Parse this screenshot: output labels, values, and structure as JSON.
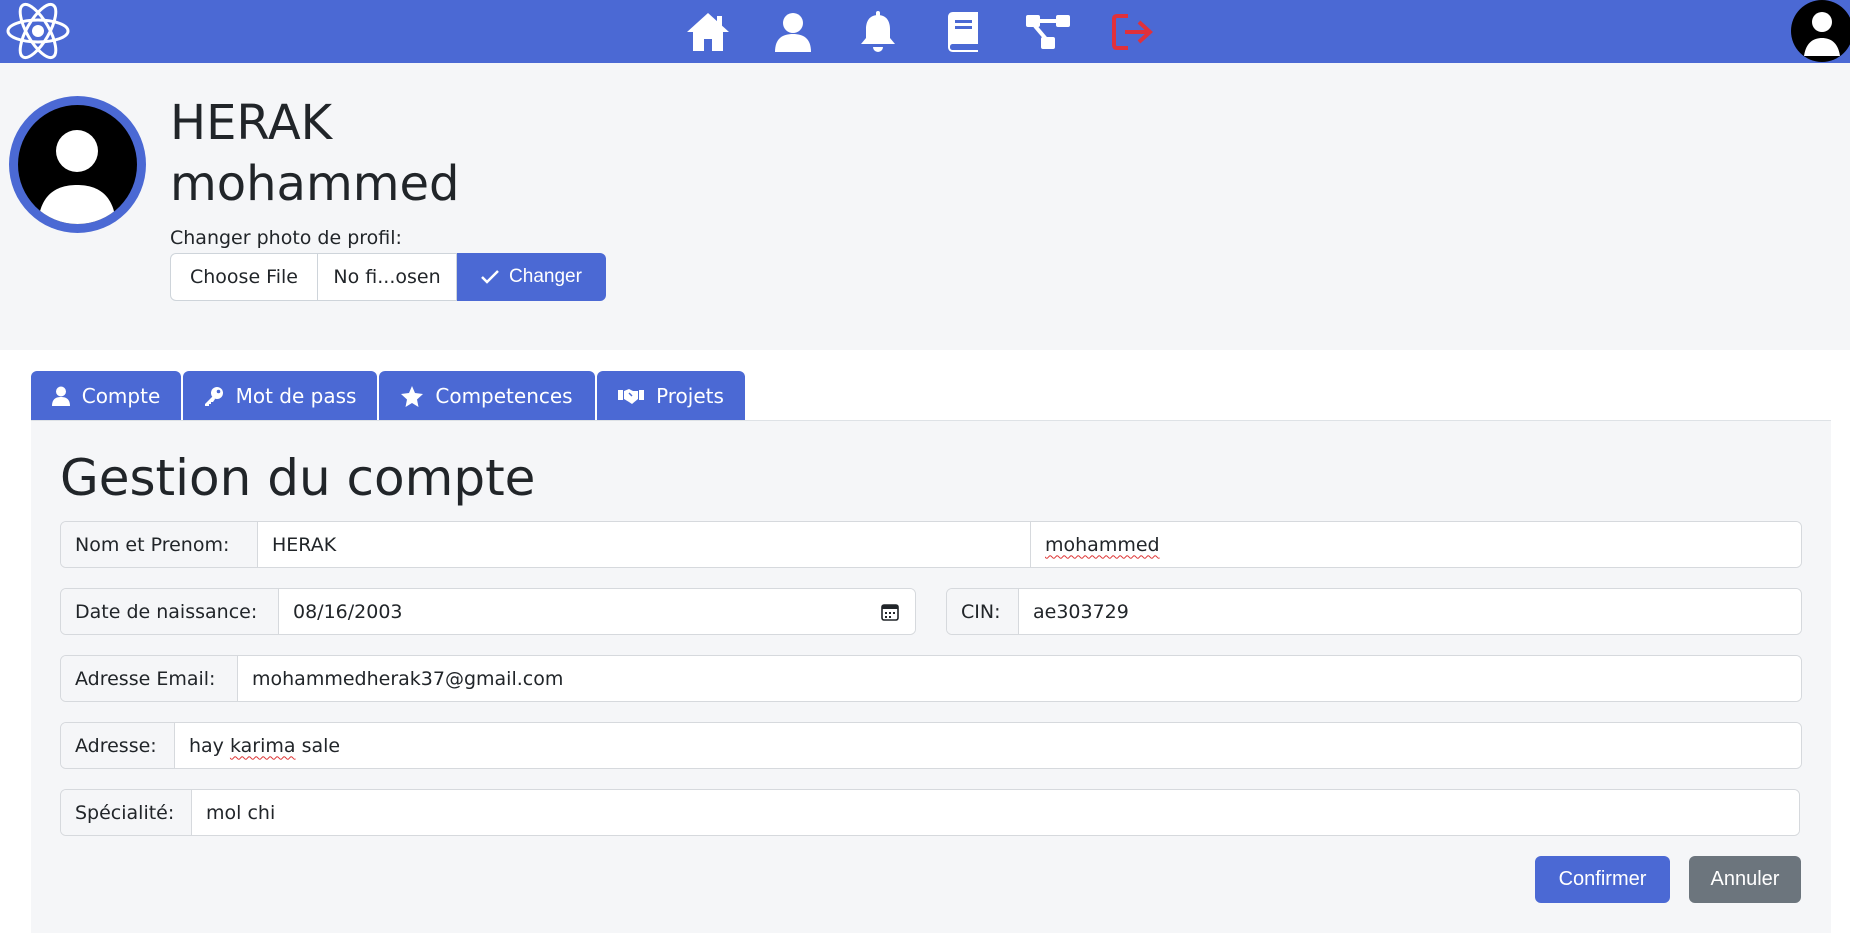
{
  "navbar": {
    "icons": [
      {
        "name": "home-icon"
      },
      {
        "name": "user-icon"
      },
      {
        "name": "bell-icon"
      },
      {
        "name": "book-icon"
      },
      {
        "name": "network-icon"
      },
      {
        "name": "logout-icon",
        "color": "#e0313b"
      }
    ]
  },
  "colors": {
    "primary": "#4b69d4",
    "secondary": "#6c757d",
    "background": "#f5f6f8",
    "logout": "#e0313b"
  },
  "profile": {
    "last_name": "HERAK",
    "first_name": "mohammed",
    "photo_label": "Changer photo de profil:",
    "choose_file_label": "Choose File",
    "file_name": "No fi...osen",
    "change_label": "Changer"
  },
  "tabs": [
    {
      "label": "Compte",
      "icon": "user-icon"
    },
    {
      "label": "Mot de pass",
      "icon": "key-icon"
    },
    {
      "label": "Competences",
      "icon": "star-icon"
    },
    {
      "label": "Projets",
      "icon": "handshake-icon"
    }
  ],
  "account": {
    "title": "Gestion du compte",
    "name_label": "Nom et Prenom:",
    "last_name": "HERAK",
    "first_name": "mohammed",
    "birth_label": "Date de naissance:",
    "birth_date": "08/16/2003",
    "cin_label": "CIN:",
    "cin": "ae303729",
    "email_label": "Adresse Email:",
    "email": "mohammedherak37@gmail.com",
    "address_label": "Adresse:",
    "address_before": "hay ",
    "address_misspelled": "karima",
    "address_after": " sale",
    "specialty_label": "Spécialité:",
    "specialty": "mol chi",
    "confirm_label": "Confirmer",
    "cancel_label": "Annuler"
  }
}
